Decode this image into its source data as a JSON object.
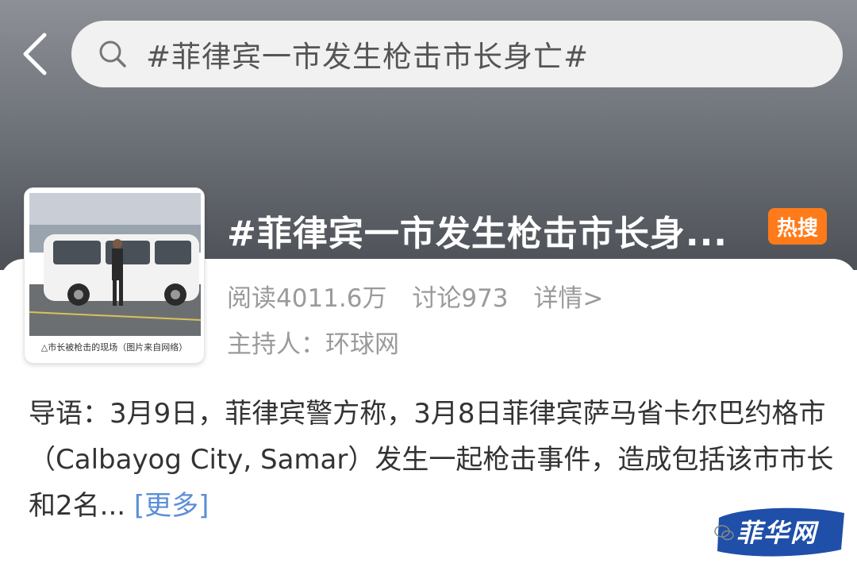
{
  "header": {
    "back_icon": "chevron-left-icon",
    "search_icon": "search-icon",
    "search_text": "#菲律宾一市发生枪击市长身亡#"
  },
  "topic": {
    "title": "#菲律宾一市发生枪击市长身...",
    "badge": "热搜",
    "badge_color": "#ff7a1a",
    "reads": "阅读4011.6万",
    "discussions": "讨论973",
    "detail_link": "详情>",
    "host": "主持人：环球网",
    "thumbnail_caption": "△市长被枪击的现场（图片来自网络）"
  },
  "intro": {
    "text": "导语：3月9日，菲律宾警方称，3月8日菲律宾萨马省卡尔巴约格市（Calbayog City, Samar）发生一起枪击事件，造成包括该市市长和2名...",
    "more_label": "[更多]",
    "more_color": "#5b8fd6"
  },
  "watermark": {
    "text": "菲华网",
    "icon": "wechat-icon"
  }
}
